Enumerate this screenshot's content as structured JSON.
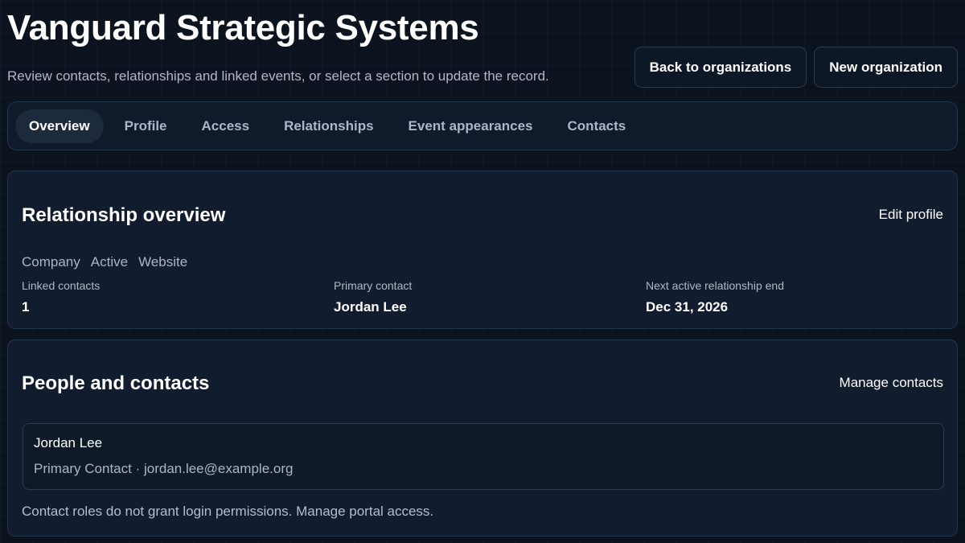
{
  "header": {
    "title": "Vanguard Strategic Systems",
    "subtitle": "Review contacts, relationships and linked events, or select a section to update the record.",
    "back_label": "Back to organizations",
    "new_label": "New organization"
  },
  "tabs": [
    {
      "label": "Overview",
      "active": true
    },
    {
      "label": "Profile",
      "active": false
    },
    {
      "label": "Access",
      "active": false
    },
    {
      "label": "Relationships",
      "active": false
    },
    {
      "label": "Event appearances",
      "active": false
    },
    {
      "label": "Contacts",
      "active": false
    }
  ],
  "overview": {
    "title": "Relationship overview",
    "edit_label": "Edit profile",
    "tags": [
      "Company",
      "Active",
      "Website"
    ],
    "stats": [
      {
        "label": "Linked contacts",
        "value": "1"
      },
      {
        "label": "Primary contact",
        "value": "Jordan Lee"
      },
      {
        "label": "Next active relationship end",
        "value": "Dec 31, 2026"
      }
    ]
  },
  "people": {
    "title": "People and contacts",
    "manage_label": "Manage contacts",
    "contact": {
      "name": "Jordan Lee",
      "meta": "Primary Contact · jordan.lee@example.org"
    },
    "note": "Contact roles do not grant login permissions. Manage portal access."
  }
}
